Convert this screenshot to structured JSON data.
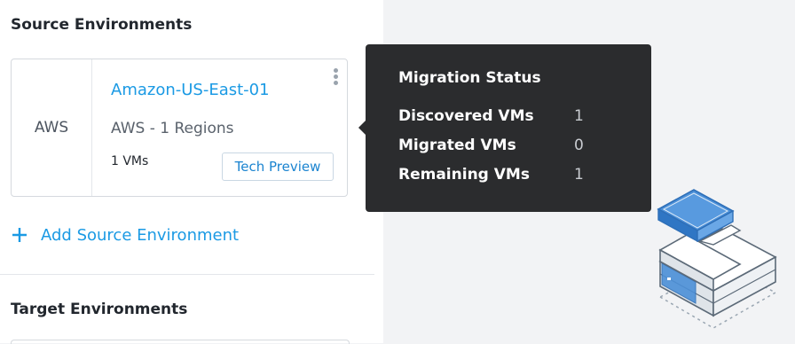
{
  "source": {
    "title": "Source Environments",
    "card": {
      "provider": "AWS",
      "name": "Amazon-US-East-01",
      "regions": "AWS - 1 Regions",
      "vms": "1 VMs",
      "badge": "Tech Preview"
    },
    "add_label": "Add Source Environment"
  },
  "target": {
    "title": "Target Environments"
  },
  "tooltip": {
    "title": "Migration Status",
    "rows": [
      {
        "label": "Discovered VMs",
        "value": "1"
      },
      {
        "label": "Migrated VMs",
        "value": "0"
      },
      {
        "label": "Remaining VMs",
        "value": "1"
      }
    ]
  },
  "colors": {
    "accent": "#1b9ae4",
    "tooltip_bg": "#2b2c2e",
    "background": "#f2f3f5"
  },
  "icons": {
    "menu": "vertical-ellipsis-icon",
    "add": "plus-icon",
    "illustration": "server-stack-illustration"
  }
}
